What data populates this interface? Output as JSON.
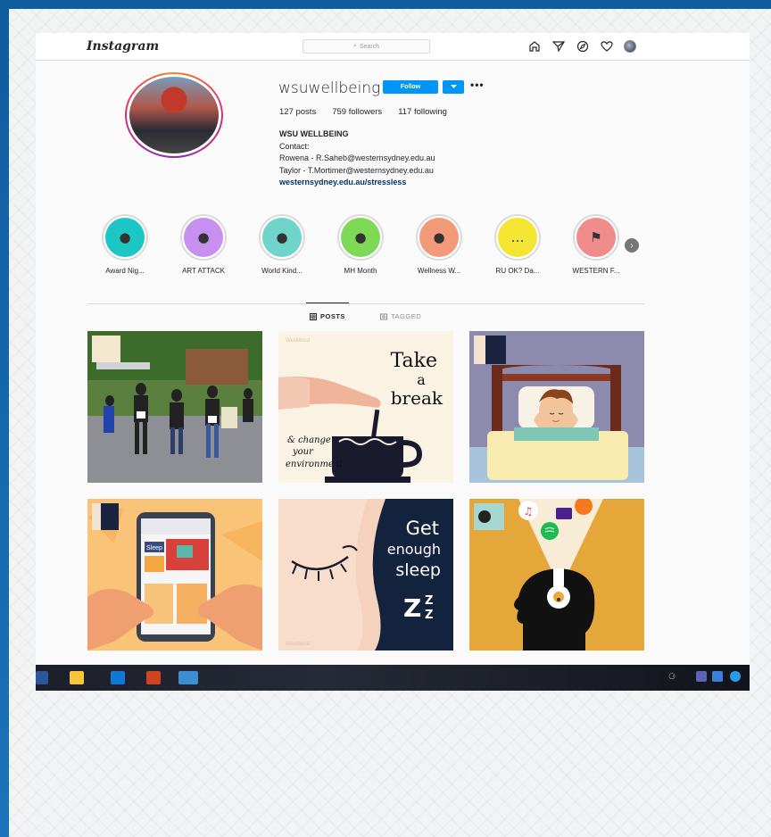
{
  "app": {
    "logo": "Instagram",
    "search_placeholder": "Search"
  },
  "profile": {
    "username": "wsuwellbeing",
    "follow_label": "Follow",
    "stats": {
      "posts": "127 posts",
      "followers": "759 followers",
      "following": "117 following"
    },
    "bio": {
      "name": "WSU WELLBEING",
      "line1": "Contact:",
      "line2": "Rowena - R.Saheb@westernsydney.edu.au",
      "line3": "Taylor - T.Mortimer@westernsydney.edu.au",
      "link": "westernsydney.edu.au/stressless"
    }
  },
  "highlights": [
    {
      "label": "Award Nig...",
      "color": "#1dc7c4",
      "icon": "handshake-icon"
    },
    {
      "label": "ART ATTACK",
      "color": "#c78ff0",
      "icon": "easel-icon"
    },
    {
      "label": "World Kind...",
      "color": "#6fd4c9",
      "icon": "hands-icon"
    },
    {
      "label": "MH Month",
      "color": "#7ed957",
      "icon": "party-popper-icon"
    },
    {
      "label": "Wellness W...",
      "color": "#f29a7a",
      "icon": "sneaker-icon"
    },
    {
      "label": "RU OK? Da...",
      "color": "#f4e533",
      "icon": "speech-bubble-icon"
    },
    {
      "label": "WESTERN F...",
      "color": "#f08c8c",
      "icon": "flag-icon"
    }
  ],
  "tabs": {
    "posts": "POSTS",
    "tagged": "TAGGED"
  },
  "posts": [
    {
      "kind": "photo",
      "name": "event-photo"
    },
    {
      "kind": "take-break",
      "lines": [
        "Take",
        "a",
        "break"
      ],
      "sub": [
        "& change",
        "your",
        "environment"
      ],
      "brand": "WesMood"
    },
    {
      "kind": "sleeping-boy",
      "name": "sleeping-illustration"
    },
    {
      "kind": "phone-app",
      "sleep_label": "Sleep"
    },
    {
      "kind": "get-sleep",
      "lines": [
        "Get",
        "enough",
        "sleep"
      ],
      "zzz": "Z",
      "brand": "WesMood"
    },
    {
      "kind": "music",
      "name": "music-head-illustration"
    }
  ],
  "colors": {
    "accent": "#0095f6",
    "link": "#00376b"
  }
}
